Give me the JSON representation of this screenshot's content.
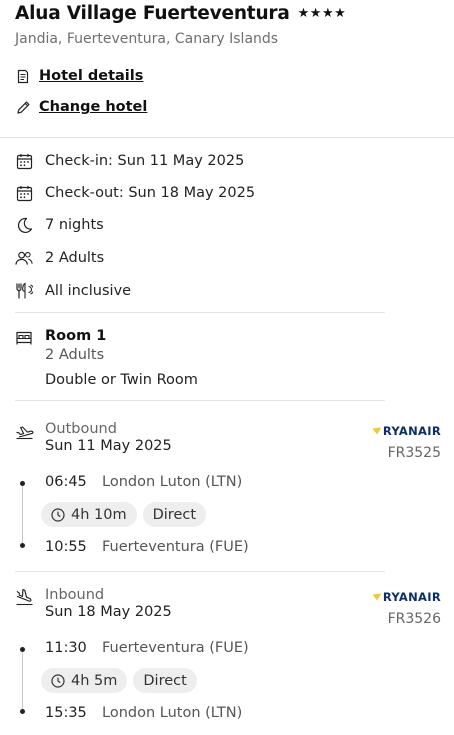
{
  "hotel": {
    "name": "Alua Village Fuerteventura",
    "stars": "★★★★",
    "location": "Jandia, Fuerteventura, Canary Islands"
  },
  "links": {
    "hotel_details": "Hotel details",
    "change_hotel": "Change hotel"
  },
  "booking": {
    "check_in": "Check-in: Sun 11 May 2025",
    "check_out": "Check-out: Sun 18 May 2025",
    "nights": "7 nights",
    "guests": "2 Adults",
    "board": "All inclusive"
  },
  "room": {
    "title": "Room 1",
    "adults": "2 Adults",
    "type": "Double or Twin Room"
  },
  "flights": {
    "outbound": {
      "label": "Outbound",
      "date": "Sun 11 May 2025",
      "airline": "RYANAIR",
      "flight_number": "FR3525",
      "depart_time": "06:45",
      "depart_airport": "London Luton (LTN)",
      "duration": "4h 10m",
      "stops": "Direct",
      "arrive_time": "10:55",
      "arrive_airport": "Fuerteventura (FUE)"
    },
    "inbound": {
      "label": "Inbound",
      "date": "Sun 18 May 2025",
      "airline": "RYANAIR",
      "flight_number": "FR3526",
      "depart_time": "11:30",
      "depart_airport": "Fuerteventura (FUE)",
      "duration": "4h 5m",
      "stops": "Direct",
      "arrive_time": "15:35",
      "arrive_airport": "London Luton (LTN)"
    }
  },
  "icons": {
    "hotel_details": "document-icon",
    "change_hotel": "pencil-icon",
    "check_in": "calendar-icon",
    "check_out": "calendar-icon",
    "nights": "moon-icon",
    "guests": "people-icon",
    "board": "cutlery-icon",
    "room": "bed-icon",
    "outbound": "plane-takeoff-icon",
    "inbound": "plane-landing-icon",
    "duration": "clock-icon"
  },
  "colors": {
    "airline_logo": "#0b2f6b",
    "airline_harp": "#f1c933",
    "chip_bg": "#eeeeee",
    "divider": "#e3e3e3"
  }
}
